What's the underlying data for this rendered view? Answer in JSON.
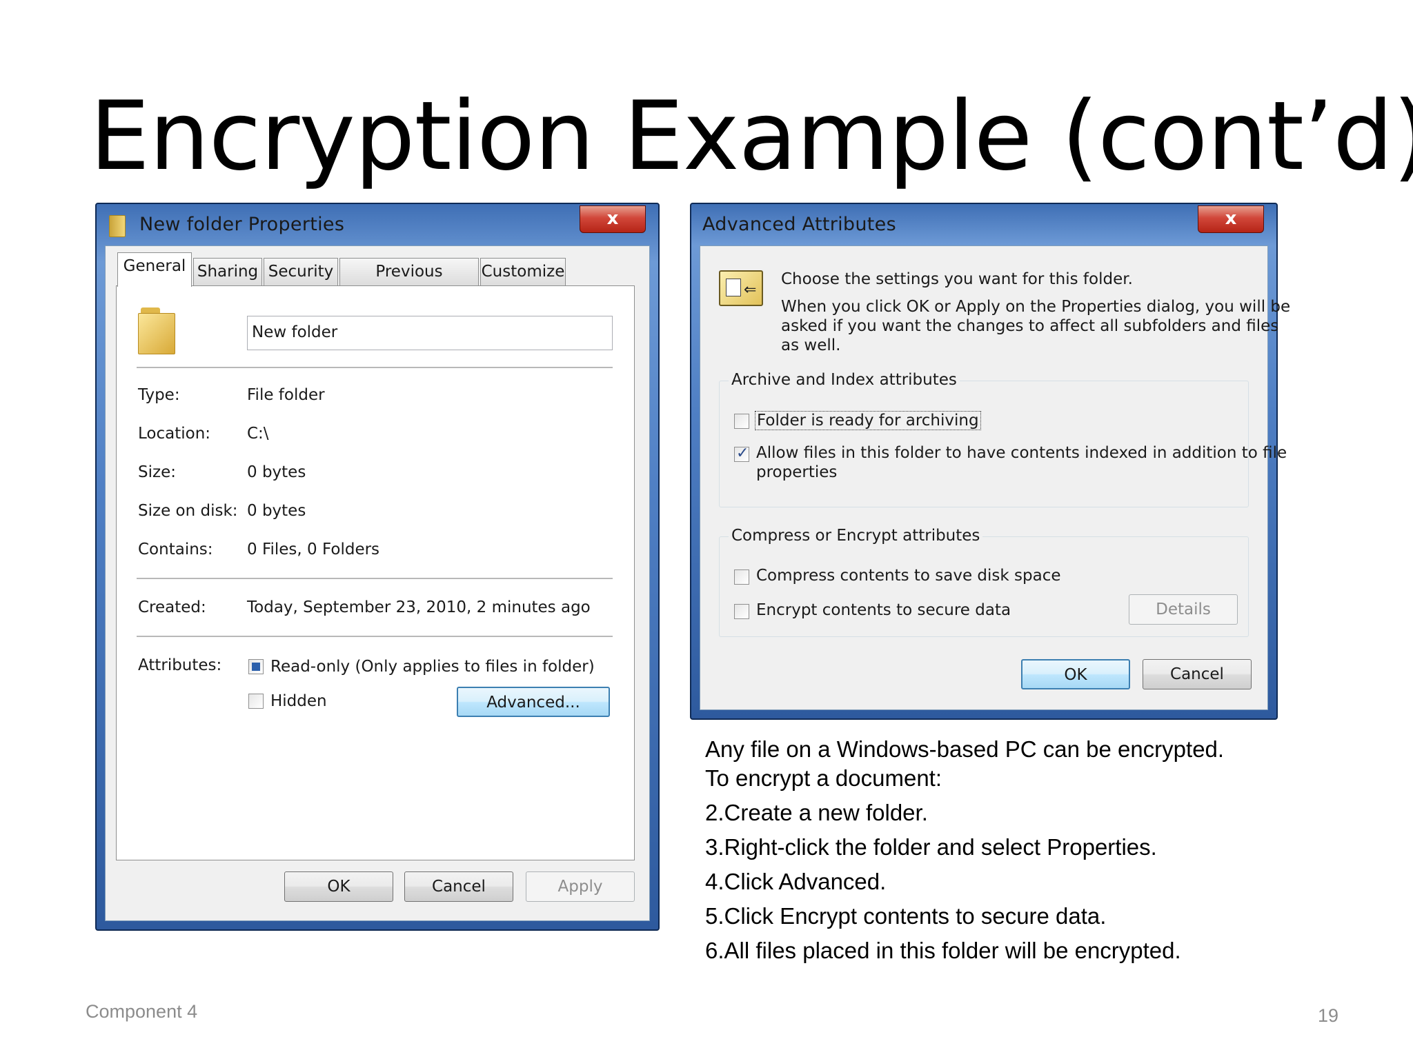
{
  "slide": {
    "title": "Encryption Example (cont’d)",
    "footer_left": "Component 4",
    "page_number": "19"
  },
  "properties_dialog": {
    "title": "New folder Properties",
    "close_label": "x",
    "tabs": [
      "General",
      "Sharing",
      "Security",
      "Previous Versions",
      "Customize"
    ],
    "active_tab": "General",
    "name_value": "New folder",
    "fields": {
      "type_label": "Type:",
      "type_value": "File folder",
      "location_label": "Location:",
      "location_value": "C:\\",
      "size_label": "Size:",
      "size_value": "0 bytes",
      "size_on_disk_label": "Size on disk:",
      "size_on_disk_value": "0 bytes",
      "contains_label": "Contains:",
      "contains_value": "0 Files, 0 Folders",
      "created_label": "Created:",
      "created_value": "Today, September 23, 2010, 2 minutes ago",
      "attributes_label": "Attributes:"
    },
    "readonly_label": "Read-only (Only applies to files in folder)",
    "hidden_label": "Hidden",
    "advanced_button": "Advanced...",
    "buttons": {
      "ok": "OK",
      "cancel": "Cancel",
      "apply": "Apply"
    }
  },
  "advanced_dialog": {
    "title": "Advanced Attributes",
    "close_label": "x",
    "intro_line1": "Choose the settings you want for this folder.",
    "intro_line2": "When you click OK or Apply on the Properties dialog, you will be",
    "intro_line3": "asked if you want the changes to affect all subfolders and files",
    "intro_line4": "as well.",
    "archive_group_title": "Archive and Index attributes",
    "archive_checkbox": "Folder is ready for archiving",
    "index_checkbox_line1": "Allow files in this folder to have contents indexed in addition to file",
    "index_checkbox_line2": "properties",
    "compress_group_title": "Compress or Encrypt attributes",
    "compress_checkbox": "Compress contents to save disk space",
    "encrypt_checkbox": "Encrypt contents to secure data",
    "details_button": "Details",
    "ok_button": "OK",
    "cancel_button": "Cancel"
  },
  "instructions": {
    "line1": "Any file on a Windows-based PC can be encrypted.",
    "line2": "To encrypt a document:",
    "steps": [
      "2.Create a new folder.",
      "3.Right-click the folder and select Properties.",
      "4.Click Advanced.",
      "5.Click Encrypt contents to secure data.",
      "6.All files placed in this folder will be encrypted."
    ]
  }
}
